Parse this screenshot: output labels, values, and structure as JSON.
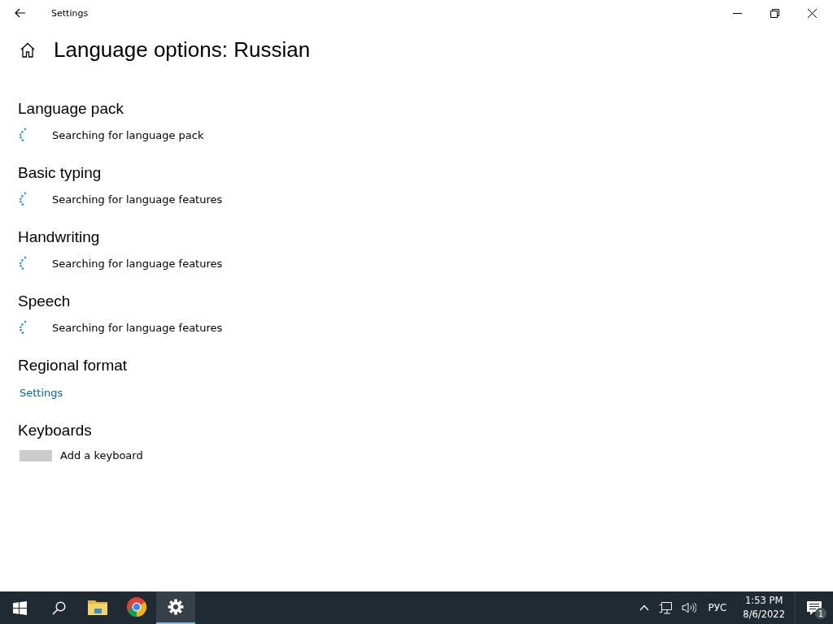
{
  "window": {
    "title": "Settings"
  },
  "page": {
    "title": "Language options: Russian"
  },
  "sections": [
    {
      "heading": "Language pack",
      "kind": "status",
      "text": "Searching for language pack"
    },
    {
      "heading": "Basic typing",
      "kind": "status",
      "text": "Searching for language features"
    },
    {
      "heading": "Handwriting",
      "kind": "status",
      "text": "Searching for language features"
    },
    {
      "heading": "Speech",
      "kind": "status",
      "text": "Searching for language features"
    },
    {
      "heading": "Regional format",
      "kind": "link",
      "text": "Settings"
    },
    {
      "heading": "Keyboards",
      "kind": "add",
      "text": "Add a keyboard"
    }
  ],
  "taskbar": {
    "apps": [
      {
        "kind": "folder",
        "selected": false
      },
      {
        "kind": "browser",
        "selected": false
      },
      {
        "kind": "settings",
        "selected": true
      }
    ],
    "language": "РУС",
    "time": "1:53 PM",
    "date": "8/6/2022",
    "notifications": "1"
  }
}
